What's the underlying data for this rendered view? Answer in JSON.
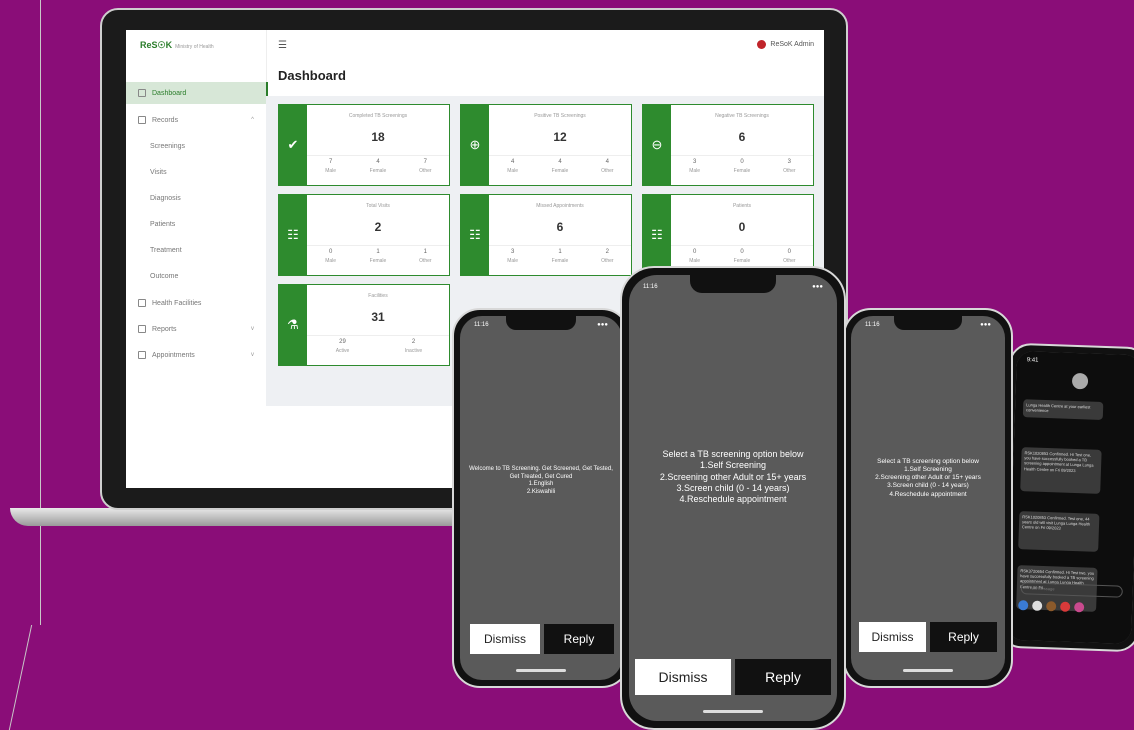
{
  "app": {
    "logo_text": "ReS☉K",
    "logo_sub": "Ministry of Health",
    "menu_icon": "menu-icon",
    "admin_name": "ReSoK Admin",
    "page_title": "Dashboard"
  },
  "sidebar": {
    "items": [
      {
        "label": "Dashboard",
        "icon": "home-icon"
      },
      {
        "label": "Records",
        "icon": "records-icon",
        "chevron": "^"
      },
      {
        "label": "Screenings"
      },
      {
        "label": "Visits"
      },
      {
        "label": "Diagnosis"
      },
      {
        "label": "Patients"
      },
      {
        "label": "Treatment"
      },
      {
        "label": "Outcome"
      },
      {
        "label": "Health Facilities",
        "icon": "facility-icon"
      },
      {
        "label": "Reports",
        "icon": "reports-icon",
        "chevron": "v"
      },
      {
        "label": "Appointments",
        "icon": "calendar-icon",
        "chevron": "v"
      }
    ]
  },
  "cards": [
    {
      "title": "Completed TB Screenings",
      "value": "18",
      "icon": "check-circle-icon",
      "cols": [
        {
          "v": "7",
          "l": "Male"
        },
        {
          "v": "4",
          "l": "Female"
        },
        {
          "v": "7",
          "l": "Other"
        }
      ]
    },
    {
      "title": "Positive TB Screenings",
      "value": "12",
      "icon": "plus-circle-icon",
      "cols": [
        {
          "v": "4",
          "l": "Male"
        },
        {
          "v": "4",
          "l": "Female"
        },
        {
          "v": "4",
          "l": "Other"
        }
      ]
    },
    {
      "title": "Negative TB Screenings",
      "value": "6",
      "icon": "minus-circle-icon",
      "cols": [
        {
          "v": "3",
          "l": "Male"
        },
        {
          "v": "0",
          "l": "Female"
        },
        {
          "v": "3",
          "l": "Other"
        }
      ]
    },
    {
      "title": "Total Visits",
      "value": "2",
      "icon": "document-icon",
      "cols": [
        {
          "v": "0",
          "l": "Male"
        },
        {
          "v": "1",
          "l": "Female"
        },
        {
          "v": "1",
          "l": "Other"
        }
      ]
    },
    {
      "title": "Missed Appointments",
      "value": "6",
      "icon": "document-alert-icon",
      "cols": [
        {
          "v": "3",
          "l": "Male"
        },
        {
          "v": "1",
          "l": "Female"
        },
        {
          "v": "2",
          "l": "Other"
        }
      ]
    },
    {
      "title": "Patients",
      "value": "0",
      "icon": "patient-record-icon",
      "cols": [
        {
          "v": "0",
          "l": "Male"
        },
        {
          "v": "0",
          "l": "Female"
        },
        {
          "v": "0",
          "l": "Other"
        }
      ]
    },
    {
      "title": "Facilities",
      "value": "31",
      "icon": "flask-icon",
      "cols": [
        {
          "v": "29",
          "l": "Active"
        },
        {
          "v": "2",
          "l": "Inactive"
        }
      ]
    }
  ],
  "phones": {
    "left": {
      "time": "11:16",
      "message": "Welcome to TB Screening. Get Screened, Get Tested, Get Treated, Get Cured\n1.English\n2.Kiswahili",
      "dismiss": "Dismiss",
      "reply": "Reply"
    },
    "center": {
      "time": "11:16",
      "message": "Select a TB screening option below\n1.Self Screening\n2.Screening other Adult or 15+ years\n3.Screen child (0 - 14 years)\n4.Reschedule appointment",
      "dismiss": "Dismiss",
      "reply": "Reply"
    },
    "right": {
      "time": "11:16",
      "message": "Select a TB screening option below\n1.Self Screening\n2.Screening other Adult or 15+ years\n3.Screen child (0 - 14 years)\n4.Reschedule appointment",
      "dismiss": "Dismiss",
      "reply": "Reply"
    },
    "messages": {
      "time": "9:41",
      "texts": [
        "Lunga Health Centre at your earliest convenience",
        "RSK1020853 Confirmed. Hi Test one, you have successfully booked a TB screening appointment at Lunga Lunga Health Centre on Fri 09/2023",
        "RSK1020853 Confirmed. Test one, 44 years old will visit Lunga Lunga Health Centre on Fri 09/2023",
        "RSK3720654 Confirmed. Hi Test two, you have successfully booked a TB screening appointment at Lunga Lunga Health Centre on Fri"
      ],
      "input_placeholder": "Text Message"
    }
  },
  "colors": {
    "background": "#8a0d78",
    "accent": "#2e8b2e",
    "admin_badge": "#c0242a"
  }
}
